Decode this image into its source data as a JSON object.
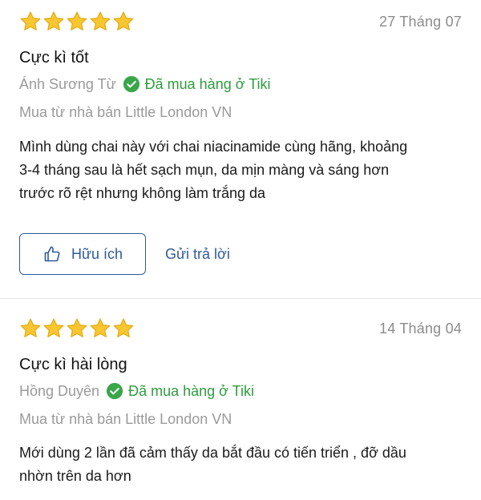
{
  "reviews": [
    {
      "rating": 5,
      "date": "27 Tháng 07",
      "title": "Cực kì tốt",
      "author": "Ánh Sương Từ",
      "verified_label": "Đã mua hàng ở Tiki",
      "seller": "Mua từ nhà bán Little London VN",
      "body_lines": [
        "Mình dùng chai này với chai niacinamide cùng hãng, khoảng",
        "3-4 tháng sau là hết sạch mụn, da mịn màng và sáng hơn",
        "trước rõ rệt nhưng không làm trắng da"
      ],
      "helpful_label": "Hữu ích",
      "reply_label": "Gửi trả lời"
    },
    {
      "rating": 5,
      "date": "14 Tháng 04",
      "title": "Cực kì hài lòng",
      "author": "Hồng Duyên",
      "verified_label": "Đã mua hàng ở Tiki",
      "seller": "Mua từ nhà bán Little London VN",
      "body_lines": [
        "Mới dùng 2 lần đã cảm thấy da bắt đầu có tiến triển , đỡ dầu",
        "nhờn trên da hơn"
      ]
    }
  ],
  "colors": {
    "star": "#f7c631",
    "star_stroke": "#e2a90f",
    "verified": "#2e9c3e",
    "link": "#2f5a9a",
    "muted": "#9a9a9a"
  },
  "icons": {
    "star": "star-icon",
    "verified": "check-circle-icon",
    "helpful": "thumbs-up-icon"
  }
}
